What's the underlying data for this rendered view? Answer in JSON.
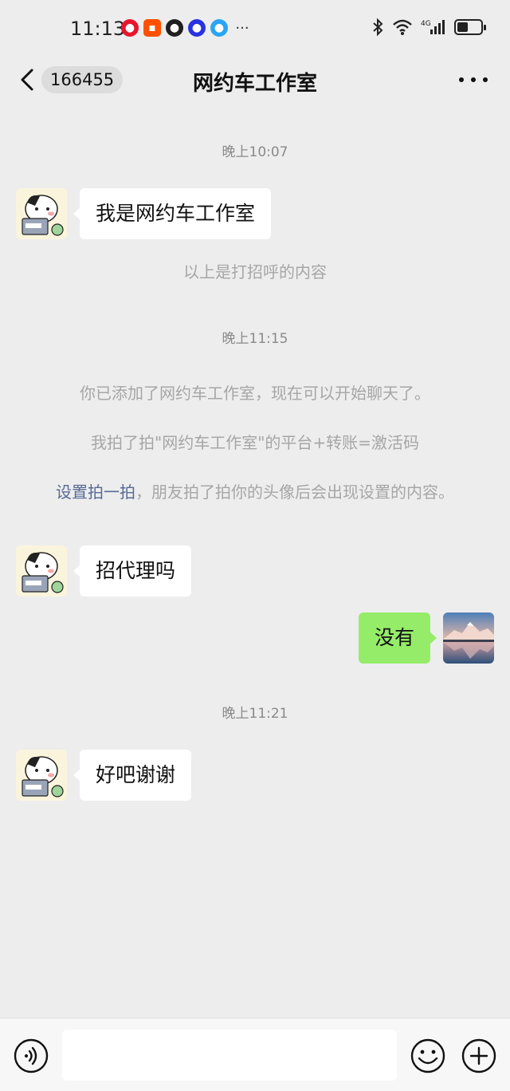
{
  "status_bar": {
    "time": "11:13",
    "notifications": [
      "weibo-icon",
      "taobao-icon",
      "qq-icon",
      "baidu-icon",
      "qq-browser-icon"
    ],
    "more": "···",
    "signal_label": "4G",
    "battery_level": 0.45
  },
  "header": {
    "unread_count": "166455",
    "title": "网约车工作室"
  },
  "messages": {
    "ts1": "晚上10:07",
    "msg1": "我是网约车工作室",
    "sys1": "以上是打招呼的内容",
    "ts2": "晚上11:15",
    "sys2": "你已添加了网约车工作室，现在可以开始聊天了。",
    "sys3": "我拍了拍\"网约车工作室\"的平台+转账=激活码",
    "sys4_link": "设置拍一拍",
    "sys4_text": "，朋友拍了拍你的头像后会出现设置的内容。",
    "msg2": "招代理吗",
    "msg3": "没有",
    "ts3": "晚上11:21",
    "msg4": "好吧谢谢"
  },
  "colors": {
    "background": "#ededed",
    "sent_bubble": "#95ec69",
    "received_bubble": "#ffffff",
    "link": "#576b95",
    "system_text": "#a6a6a6"
  },
  "icons": {
    "back": "chevron-left-icon",
    "more": "more-dots-icon",
    "voice": "voice-icon",
    "emoji": "emoji-icon",
    "plus": "plus-icon"
  }
}
